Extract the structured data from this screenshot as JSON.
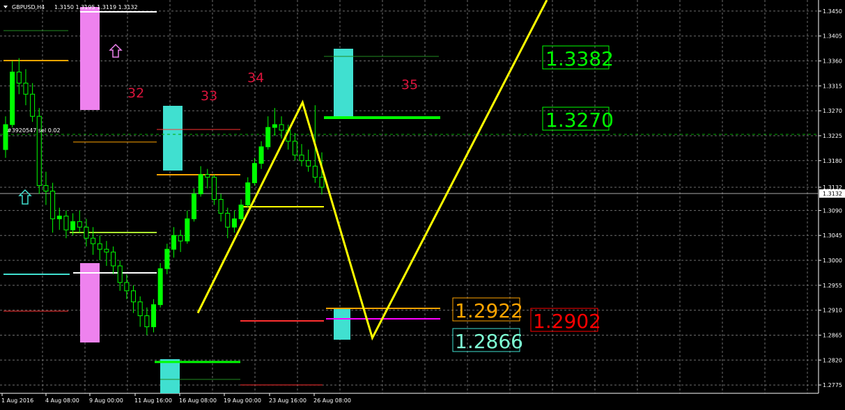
{
  "header": {
    "symbol_label": "GBPUSD,H4",
    "ohlc_text": "1.3150 1.3195 1.3119 1.3132"
  },
  "order_label": "#3",
  "order_label_rest": "920547 sel 0.02",
  "current_price": "1.3132",
  "wave_labels": [
    "32",
    "33",
    "34",
    "35"
  ],
  "price_labels": {
    "target_high": "1.3382",
    "target_mid": "1.3270",
    "orange_level": "1.2922",
    "red_level": "1.2902",
    "cyan_level": "1.2866"
  },
  "colors": {
    "background": "#000000",
    "grid": "#3a3a3a",
    "bull_candle": "#00ff00",
    "bear_candle": "#000000",
    "candle_border": "#00ff00",
    "yellow_pattern": "#ffff00",
    "magenta_zone": "#ee82ee",
    "cyan_zone": "#40e0d0",
    "green_text": "#00ff00",
    "orange_text": "#ffa500",
    "red_text": "#ff0000",
    "cyan_text": "#7fffd4",
    "wave_text": "#dc143c"
  },
  "chart_data": {
    "type": "candlestick",
    "symbol": "GBPUSD",
    "timeframe": "H4",
    "y_axis": {
      "ticks": [
        "1.3450",
        "1.3405",
        "1.3360",
        "1.3315",
        "1.3270",
        "1.3225",
        "1.3180",
        "1.3132",
        "1.3090",
        "1.3045",
        "1.3000",
        "1.2955",
        "1.2910",
        "1.2865",
        "1.2820",
        "1.2775"
      ],
      "range": [
        1.276,
        1.347
      ]
    },
    "x_axis": {
      "ticks": [
        "1 Aug 2016",
        "4 Aug 08:00",
        "9 Aug 00:00",
        "11 Aug 16:00",
        "16 Aug 08:00",
        "19 Aug 00:00",
        "23 Aug 16:00",
        "26 Aug 08:00"
      ]
    },
    "closes": [
      1.3245,
      1.334,
      1.332,
      1.33,
      1.326,
      1.3135,
      1.3125,
      1.3075,
      1.308,
      1.3055,
      1.307,
      1.306,
      1.304,
      1.303,
      1.302,
      1.3015,
      1.299,
      1.296,
      1.2945,
      1.2925,
      1.29,
      1.288,
      1.292,
      1.2985,
      1.302,
      1.3045,
      1.3035,
      1.3075,
      1.312,
      1.3155,
      1.315,
      1.311,
      1.3085,
      1.306,
      1.3075,
      1.31,
      1.314,
      1.3175,
      1.3205,
      1.324,
      1.3245,
      1.3235,
      1.3215,
      1.319,
      1.318,
      1.317,
      1.315,
      1.3132
    ],
    "ohlc": [
      [
        1.32,
        1.326,
        1.3185,
        1.3245
      ],
      [
        1.3245,
        1.336,
        1.324,
        1.334
      ],
      [
        1.334,
        1.3365,
        1.33,
        1.332
      ],
      [
        1.332,
        1.3345,
        1.328,
        1.33
      ],
      [
        1.33,
        1.332,
        1.325,
        1.326
      ],
      [
        1.326,
        1.3275,
        1.312,
        1.3135
      ],
      [
        1.3135,
        1.316,
        1.31,
        1.3125
      ],
      [
        1.3125,
        1.314,
        1.305,
        1.3075
      ],
      [
        1.3075,
        1.3095,
        1.3055,
        1.308
      ],
      [
        1.308,
        1.309,
        1.304,
        1.3055
      ],
      [
        1.3055,
        1.3085,
        1.3045,
        1.307
      ],
      [
        1.307,
        1.309,
        1.305,
        1.306
      ],
      [
        1.306,
        1.3075,
        1.3025,
        1.304
      ],
      [
        1.304,
        1.306,
        1.301,
        1.303
      ],
      [
        1.303,
        1.3045,
        1.3,
        1.302
      ],
      [
        1.302,
        1.3035,
        1.299,
        1.3015
      ],
      [
        1.3015,
        1.3025,
        1.2975,
        1.299
      ],
      [
        1.299,
        1.3,
        1.2945,
        1.296
      ],
      [
        1.296,
        1.2975,
        1.293,
        1.2945
      ],
      [
        1.2945,
        1.2955,
        1.2905,
        1.2925
      ],
      [
        1.2925,
        1.2935,
        1.288,
        1.29
      ],
      [
        1.29,
        1.2915,
        1.2865,
        1.288
      ],
      [
        1.288,
        1.293,
        1.287,
        1.292
      ],
      [
        1.292,
        1.2995,
        1.2915,
        1.2985
      ],
      [
        1.2985,
        1.303,
        1.2975,
        1.302
      ],
      [
        1.302,
        1.306,
        1.3005,
        1.3045
      ],
      [
        1.3045,
        1.3055,
        1.3015,
        1.3035
      ],
      [
        1.3035,
        1.309,
        1.303,
        1.3075
      ],
      [
        1.3075,
        1.313,
        1.307,
        1.312
      ],
      [
        1.312,
        1.317,
        1.3115,
        1.3155
      ],
      [
        1.3155,
        1.3165,
        1.313,
        1.315
      ],
      [
        1.315,
        1.3155,
        1.31,
        1.311
      ],
      [
        1.311,
        1.312,
        1.307,
        1.3085
      ],
      [
        1.3085,
        1.3095,
        1.304,
        1.306
      ],
      [
        1.306,
        1.309,
        1.305,
        1.3075
      ],
      [
        1.3075,
        1.311,
        1.307,
        1.31
      ],
      [
        1.31,
        1.315,
        1.3095,
        1.314
      ],
      [
        1.314,
        1.3185,
        1.3135,
        1.3175
      ],
      [
        1.3175,
        1.3215,
        1.3165,
        1.3205
      ],
      [
        1.3205,
        1.326,
        1.32,
        1.324
      ],
      [
        1.324,
        1.3275,
        1.3225,
        1.3245
      ],
      [
        1.3245,
        1.326,
        1.322,
        1.3235
      ],
      [
        1.3235,
        1.3245,
        1.32,
        1.3215
      ],
      [
        1.3215,
        1.323,
        1.318,
        1.319
      ],
      [
        1.319,
        1.321,
        1.317,
        1.318
      ],
      [
        1.318,
        1.32,
        1.316,
        1.317
      ],
      [
        1.317,
        1.328,
        1.314,
        1.315
      ],
      [
        1.315,
        1.3195,
        1.3119,
        1.3132
      ]
    ],
    "pattern": {
      "points": [
        [
          0.0,
          1.2905
        ],
        [
          0.3,
          1.3285
        ],
        [
          0.5,
          1.286
        ],
        [
          1.0,
          1.347
        ]
      ]
    },
    "levels": [
      {
        "price": 1.3382,
        "color": "#00ff00"
      },
      {
        "price": 1.327,
        "color": "#00ff00"
      },
      {
        "price": 1.2922,
        "color": "#ffa500"
      },
      {
        "price": 1.2902,
        "color": "#ff0000"
      },
      {
        "price": 1.2866,
        "color": "#40e0d0"
      }
    ]
  }
}
